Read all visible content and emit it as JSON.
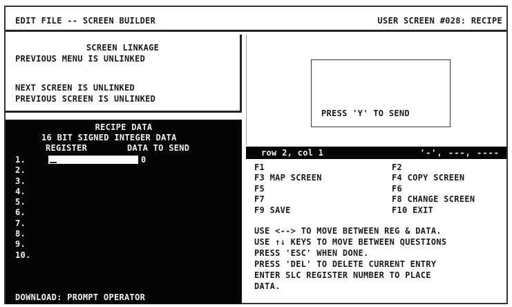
{
  "header": {
    "left": "EDIT FILE -- SCREEN BUILDER",
    "right": "USER SCREEN #028: RECIPE"
  },
  "linkage": {
    "title": "SCREEN LINKAGE",
    "previous_menu": "PREVIOUS MENU IS UNLINKED",
    "next_screen": "NEXT SCREEN IS UNLINKED",
    "previous_screen": "PREVIOUS SCREEN IS UNLINKED"
  },
  "recipe": {
    "title": "RECIPE DATA",
    "subtitle": "16 BIT SIGNED INTEGER DATA",
    "col_register": "REGISTER",
    "col_data": "DATA TO SEND",
    "rows": [
      {
        "num": "1.",
        "value": "0"
      },
      {
        "num": "2.",
        "value": ""
      },
      {
        "num": "3.",
        "value": ""
      },
      {
        "num": "4.",
        "value": ""
      },
      {
        "num": "5.",
        "value": ""
      },
      {
        "num": "6.",
        "value": ""
      },
      {
        "num": "7.",
        "value": ""
      },
      {
        "num": "8.",
        "value": ""
      },
      {
        "num": "9.",
        "value": ""
      },
      {
        "num": "10.",
        "value": ""
      }
    ],
    "footer": "DOWNLOAD: PROMPT OPERATOR"
  },
  "prompt": {
    "text": "PRESS 'Y' TO SEND"
  },
  "status": {
    "position": "row 2, col 1",
    "marks": "'-', ---, ----"
  },
  "keys": [
    {
      "a": "F1",
      "b": "F2"
    },
    {
      "a": "F3 MAP SCREEN",
      "b": "F4  COPY SCREEN"
    },
    {
      "a": "F5",
      "b": "F6"
    },
    {
      "a": "F7",
      "b": "F8  CHANGE SCREEN"
    },
    {
      "a": "F9 SAVE",
      "b": "F10 EXIT"
    }
  ],
  "help": [
    "USE <--> TO MOVE BETWEEN REG & DATA.",
    "USE ↑↓ KEYS TO MOVE BETWEEN QUESTIONS",
    "PRESS 'ESC' WHEN DONE.",
    "PRESS 'DEL' TO DELETE CURRENT ENTRY",
    "ENTER SLC REGISTER NUMBER TO PLACE",
    "DATA."
  ]
}
